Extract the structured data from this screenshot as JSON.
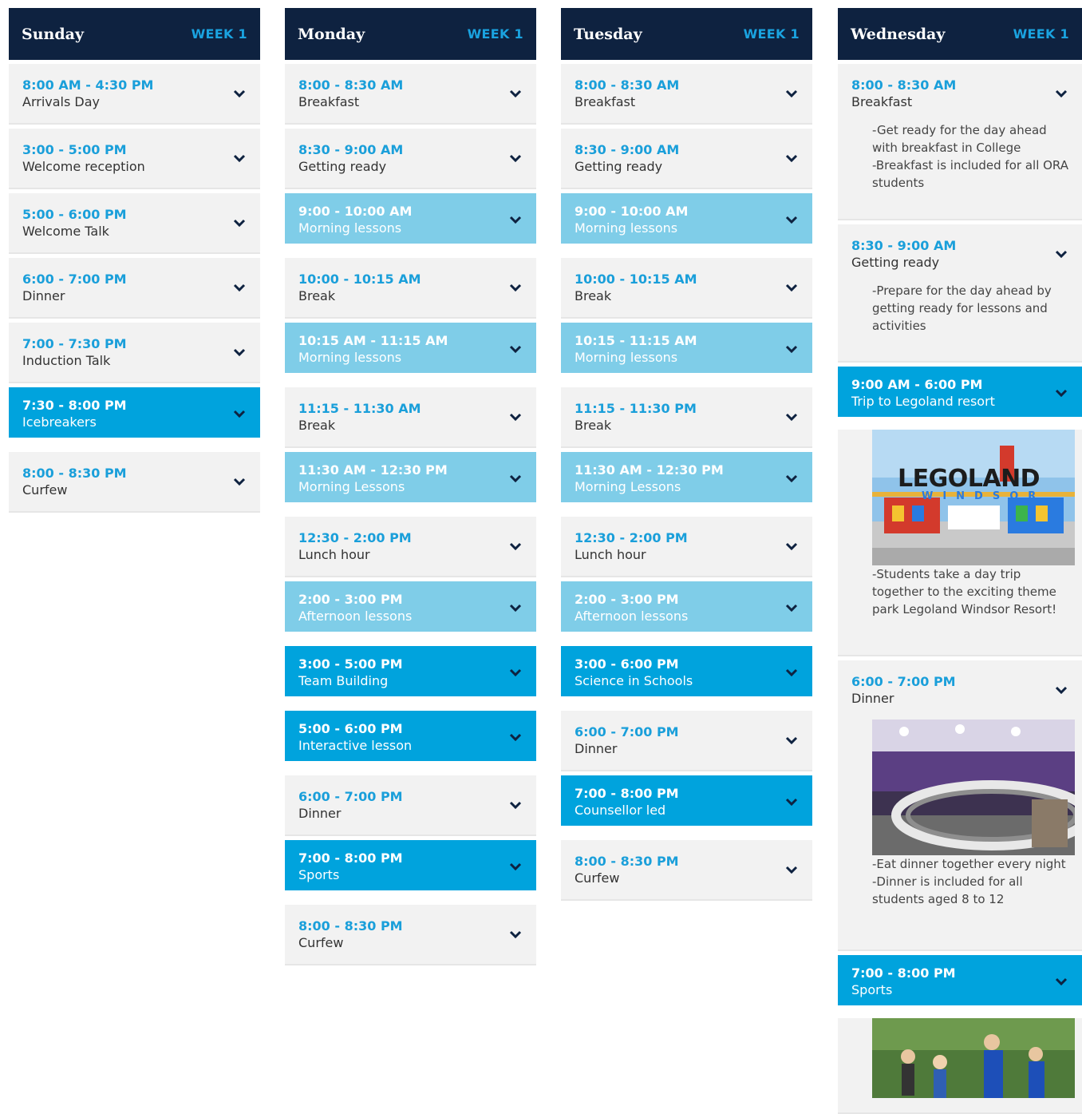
{
  "days": [
    {
      "name": "Sunday",
      "week": "WEEK 1",
      "items": [
        {
          "time": "8:00 AM - 4:30 PM",
          "label": "Arrivals Day"
        },
        {
          "time": "3:00 - 5:00 PM",
          "label": "Welcome reception"
        },
        {
          "time": "5:00 - 6:00 PM",
          "label": "Welcome Talk"
        },
        {
          "time": "6:00 - 7:00 PM",
          "label": "Dinner"
        },
        {
          "time": "7:00 - 7:30 PM",
          "label": "Induction Talk"
        },
        {
          "time": "7:30 - 8:00 PM",
          "label": "Icebreakers"
        },
        {
          "time": "8:00 - 8:30 PM",
          "label": "Curfew"
        }
      ]
    },
    {
      "name": "Monday",
      "week": "WEEK 1",
      "items": [
        {
          "time": "8:00 - 8:30 AM",
          "label": "Breakfast"
        },
        {
          "time": "8:30 - 9:00 AM",
          "label": "Getting ready"
        },
        {
          "time": "9:00 - 10:00 AM",
          "label": "Morning lessons"
        },
        {
          "time": "10:00 - 10:15 AM",
          "label": "Break"
        },
        {
          "time": "10:15 AM - 11:15 AM",
          "label": "Morning lessons"
        },
        {
          "time": "11:15 - 11:30 AM",
          "label": "Break"
        },
        {
          "time": "11:30 AM - 12:30 PM",
          "label": "Morning Lessons"
        },
        {
          "time": "12:30 - 2:00 PM",
          "label": "Lunch hour"
        },
        {
          "time": "2:00 - 3:00 PM",
          "label": "Afternoon lessons"
        },
        {
          "time": "3:00 - 5:00 PM",
          "label": "Team Building"
        },
        {
          "time": "5:00 - 6:00 PM",
          "label": "Interactive lesson"
        },
        {
          "time": "6:00 - 7:00 PM",
          "label": "Dinner"
        },
        {
          "time": "7:00 - 8:00 PM",
          "label": "Sports"
        },
        {
          "time": "8:00 - 8:30 PM",
          "label": "Curfew"
        }
      ]
    },
    {
      "name": "Tuesday",
      "week": "WEEK 1",
      "items": [
        {
          "time": "8:00 - 8:30 AM",
          "label": "Breakfast"
        },
        {
          "time": "8:30 - 9:00 AM",
          "label": "Getting ready"
        },
        {
          "time": "9:00 - 10:00 AM",
          "label": "Morning lessons"
        },
        {
          "time": "10:00 - 10:15 AM",
          "label": "Break"
        },
        {
          "time": "10:15 - 11:15 AM",
          "label": "Morning lessons"
        },
        {
          "time": "11:15 - 11:30 PM",
          "label": "Break"
        },
        {
          "time": "11:30 AM - 12:30 PM",
          "label": "Morning Lessons"
        },
        {
          "time": "12:30 - 2:00 PM",
          "label": "Lunch hour"
        },
        {
          "time": "2:00 - 3:00 PM",
          "label": "Afternoon lessons"
        },
        {
          "time": "3:00 - 6:00 PM",
          "label": "Science in Schools"
        },
        {
          "time": "6:00 - 7:00 PM",
          "label": "Dinner"
        },
        {
          "time": "7:00 - 8:00 PM",
          "label": "Counsellor led"
        },
        {
          "time": "8:00 - 8:30 PM",
          "label": "Curfew"
        }
      ]
    },
    {
      "name": "Wednesday",
      "week": "WEEK 1",
      "items": [
        {
          "time": "8:00 - 8:30 AM",
          "label": "Breakfast",
          "desc": [
            "-Get ready for the day ahead with breakfast in College",
            "-Breakfast is included for all ORA students"
          ]
        },
        {
          "time": "8:30 - 9:00 AM",
          "label": "Getting ready",
          "desc": [
            "-Prepare for the day ahead by getting ready for lessons and activities"
          ]
        },
        {
          "time": "9:00 AM - 6:00 PM",
          "label": "Trip to Legoland resort",
          "logo_text": "LEGOLAND",
          "logo_sub": "WINDSOR",
          "desc": [
            "-Students take a day trip together to the exciting theme park Legoland Windsor Resort!"
          ]
        },
        {
          "time": "6:00 - 7:00 PM",
          "label": "Dinner",
          "desc": [
            "-Eat dinner together every night",
            "-Dinner is included for all students aged 8 to 12"
          ]
        },
        {
          "time": "7:00 - 8:00 PM",
          "label": "Sports"
        }
      ]
    }
  ]
}
